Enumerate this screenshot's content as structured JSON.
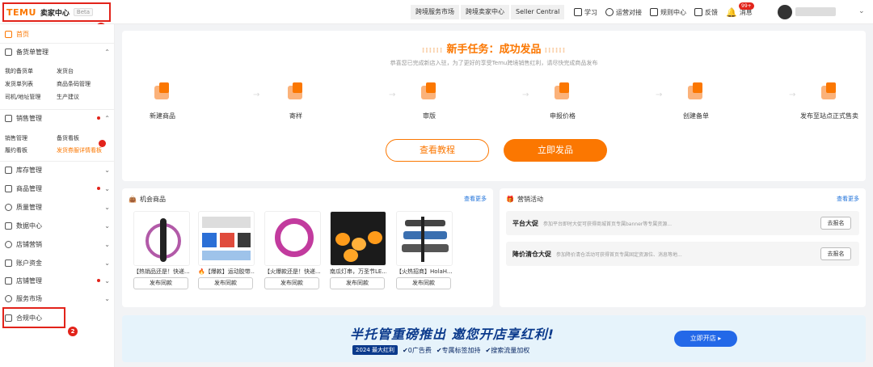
{
  "header": {
    "logo": "TEMU",
    "title": "卖家中心",
    "beta": "Beta",
    "badge_1": "1",
    "nav": [
      "跨境服务市场",
      "跨境卖家中心",
      "Seller Central"
    ],
    "icons": [
      {
        "label": "学习",
        "icon": "book-icon"
      },
      {
        "label": "运营对接",
        "icon": "chat-icon"
      },
      {
        "label": "规则中心",
        "icon": "rule-icon"
      },
      {
        "label": "反馈",
        "icon": "feedback-icon"
      },
      {
        "label": "消息",
        "icon": "bell-icon"
      }
    ],
    "msg_count": "99+"
  },
  "sidebar": {
    "home": "首页",
    "sections": [
      {
        "label": "备货单管理",
        "items": [
          [
            "我的备货单",
            "发货台"
          ],
          [
            "发货单列表",
            "商品条码管理"
          ],
          [
            "司机/地址管理",
            "生产建议"
          ]
        ]
      },
      {
        "label": "销售管理",
        "items": [
          [
            "销售管理",
            "备货看板"
          ],
          [
            "履约看板",
            "发货券服详情看板"
          ]
        ]
      }
    ],
    "menus": [
      "库存管理",
      "商品管理",
      "质量管理",
      "数据中心",
      "店铺营销",
      "账户资金",
      "店铺管理",
      "服务市场",
      "合规中心"
    ],
    "badge_2": "2"
  },
  "onboarding": {
    "title": "新手任务：成功发品",
    "subtitle": "恭喜您已完成新店入驻，为了更好的享受Temu跨境销售红利，请尽快完成商品发布",
    "steps": [
      "新建商品",
      "寄样",
      "审版",
      "申报价格",
      "创建备单",
      "发布至站点正式售卖"
    ],
    "btn_tutorial": "查看教程",
    "btn_publish": "立即发品"
  },
  "opportunity": {
    "title": "机会商品",
    "more": "查看更多",
    "publish_label": "发布同款",
    "products": [
      {
        "name": "【热销品还是！快递..."
      },
      {
        "name": "🔥【爆款】运动胶带..."
      },
      {
        "name": "【火爆款还是！快递..."
      },
      {
        "name": "南瓜灯串，万圣节LE..."
      },
      {
        "name": "【火热招商】HolaH..."
      }
    ]
  },
  "marketing": {
    "title": "营销活动",
    "more": "查看更多",
    "rows": [
      {
        "title": "平台大促",
        "desc": "参加平台即时大促可获得商城首页专属banner等专属资源...",
        "btn": "去报名"
      },
      {
        "title": "降价清仓大促",
        "desc": "参加降价清仓活动可获得首页专属固定资源位、消息等地...",
        "btn": "去报名"
      }
    ]
  },
  "banner": {
    "title": "半托管重磅推出 邀您开店享红利!",
    "tag": "2024 最大红利",
    "points": [
      "✔0广告费",
      "✔专属标签加持",
      "✔搜索流量加权"
    ],
    "btn": "立即开店 ▸"
  }
}
